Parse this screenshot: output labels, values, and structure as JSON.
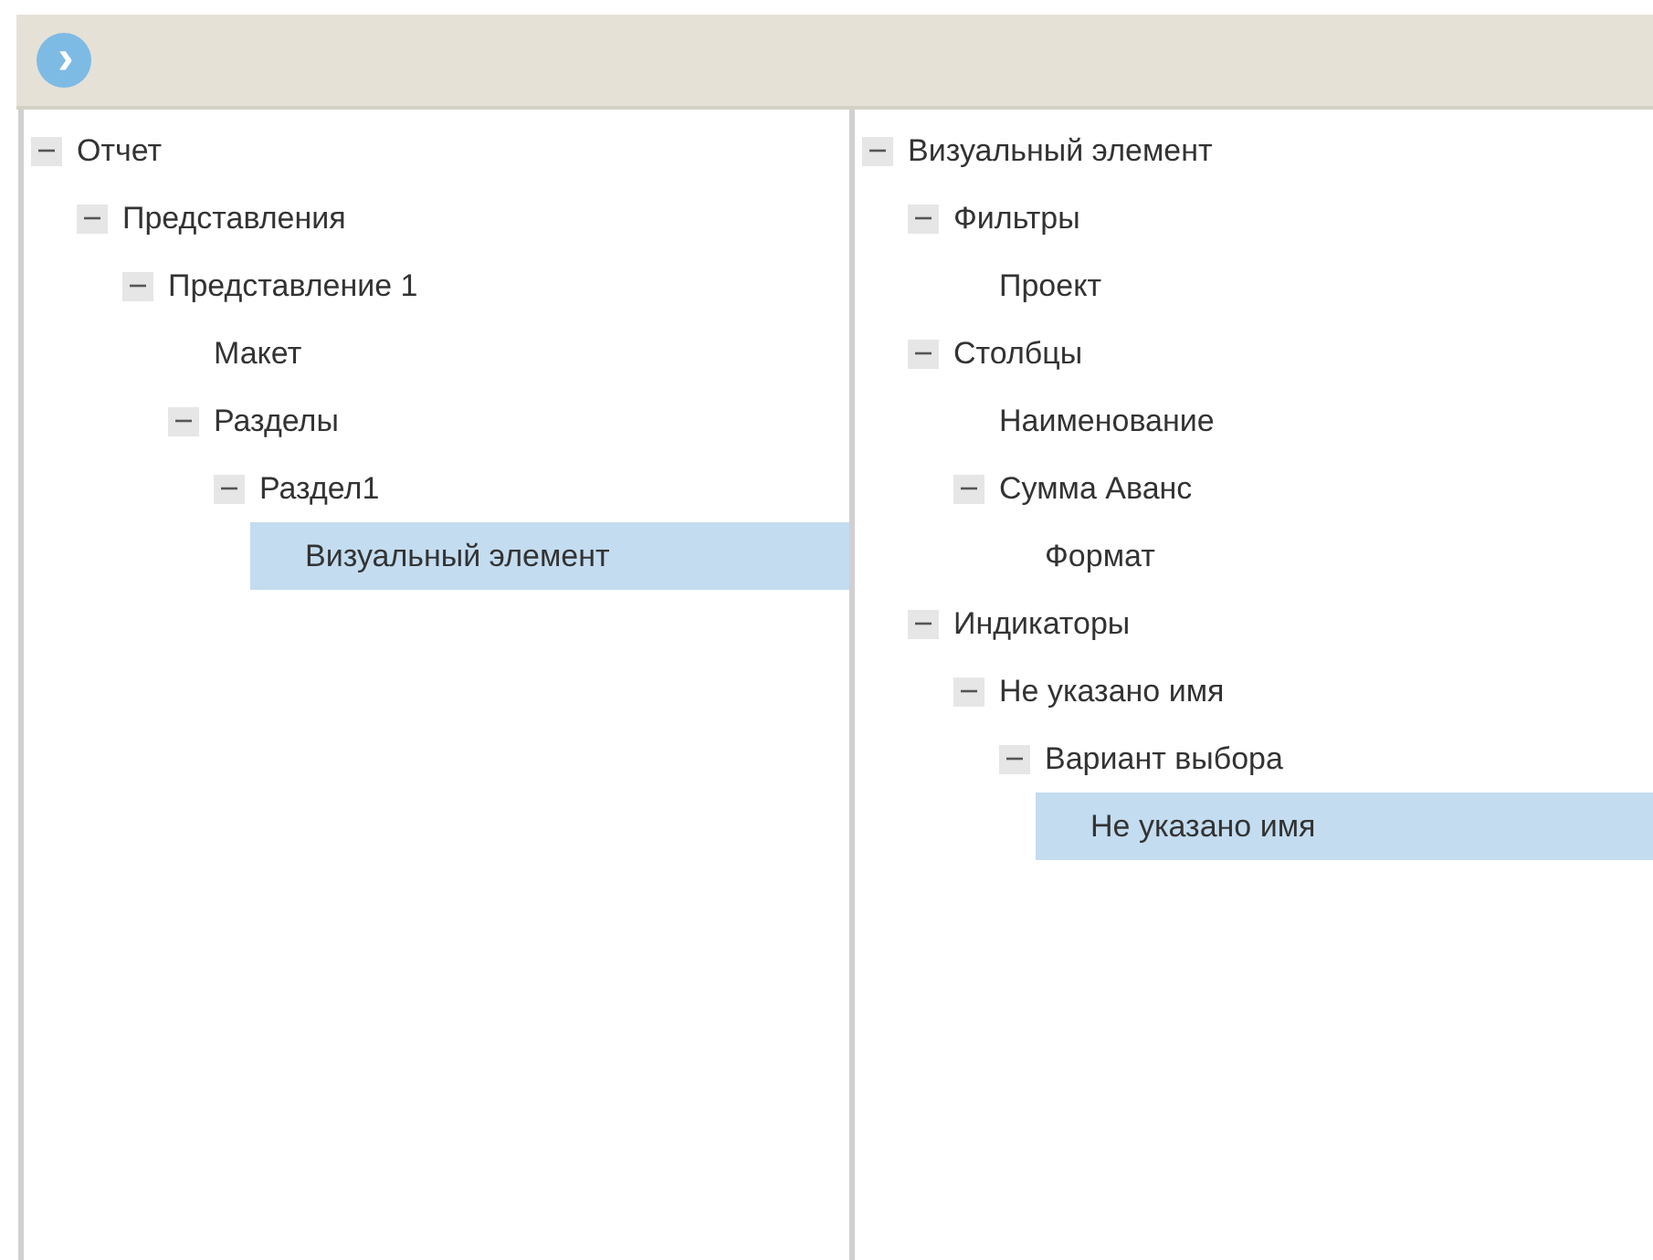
{
  "toolbar": {
    "button": "›"
  },
  "panels": [
    {
      "tree": [
        {
          "label": "Отчет",
          "expanded": true,
          "selected": false,
          "children": [
            {
              "label": "Представления",
              "expanded": true,
              "selected": false,
              "children": [
                {
                  "label": "Представление 1",
                  "expanded": true,
                  "selected": false,
                  "children": [
                    {
                      "label": "Макет",
                      "selected": false
                    },
                    {
                      "label": "Разделы",
                      "expanded": true,
                      "selected": false,
                      "children": [
                        {
                          "label": "Раздел1",
                          "expanded": true,
                          "selected": false,
                          "children": [
                            {
                              "label": "Визуальный элемент",
                              "selected": true
                            }
                          ]
                        }
                      ]
                    }
                  ]
                }
              ]
            }
          ]
        }
      ]
    },
    {
      "tree": [
        {
          "label": "Визуальный элемент",
          "expanded": true,
          "selected": false,
          "children": [
            {
              "label": "Фильтры",
              "expanded": true,
              "selected": false,
              "children": [
                {
                  "label": "Проект",
                  "selected": false
                }
              ]
            },
            {
              "label": "Столбцы",
              "expanded": true,
              "selected": false,
              "children": [
                {
                  "label": "Наименование",
                  "selected": false
                },
                {
                  "label": "Сумма Аванс",
                  "expanded": true,
                  "selected": false,
                  "children": [
                    {
                      "label": "Формат",
                      "selected": false
                    }
                  ]
                }
              ]
            },
            {
              "label": "Индикаторы",
              "expanded": true,
              "selected": false,
              "children": [
                {
                  "label": "Не указано имя",
                  "expanded": true,
                  "selected": false,
                  "children": [
                    {
                      "label": "Вариант выбора",
                      "expanded": true,
                      "selected": false,
                      "children": [
                        {
                          "label": "Не указано имя",
                          "selected": true
                        }
                      ]
                    }
                  ]
                }
              ]
            }
          ]
        }
      ]
    }
  ]
}
